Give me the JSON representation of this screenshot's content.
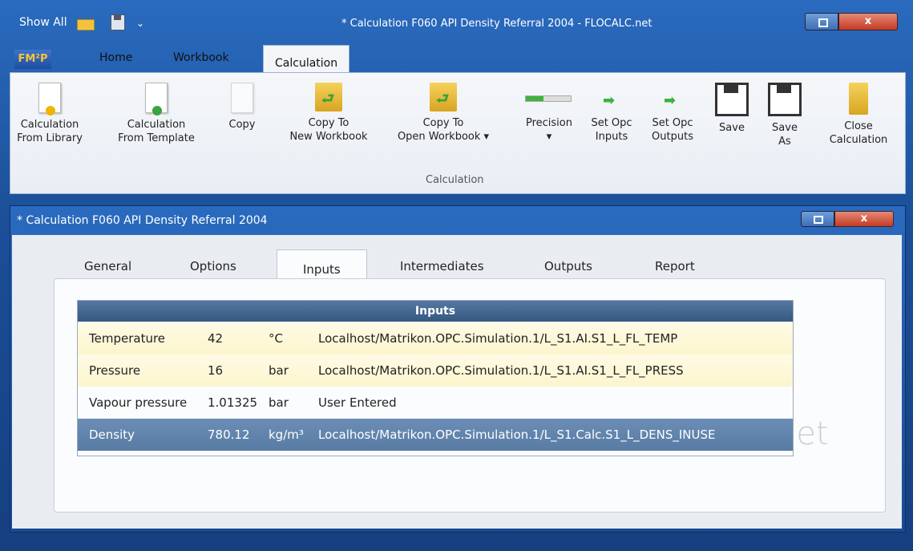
{
  "titlebar": {
    "show_all": "Show All",
    "chevron": "⌄",
    "title": "* Calculation F060 API Density Referral 2004  - FLOCALC.net",
    "close": "x"
  },
  "ribbon": {
    "fmp": "FM²P",
    "tabs": [
      "Home",
      "Workbook",
      "Calculation"
    ],
    "buttons": [
      {
        "l1": "Calculation",
        "l2": "From Library"
      },
      {
        "l1": "Calculation",
        "l2": "From Template"
      },
      {
        "l1": "Copy",
        "l2": ""
      },
      {
        "l1": "Copy To",
        "l2": "New Workbook"
      },
      {
        "l1": "Copy To",
        "l2": "Open Workbook ▾"
      },
      {
        "l1": "Precision",
        "l2": "▾"
      },
      {
        "l1": "Set Opc",
        "l2": "Inputs"
      },
      {
        "l1": "Set Opc",
        "l2": "Outputs"
      },
      {
        "l1": "Save",
        "l2": ""
      },
      {
        "l1": "Save",
        "l2": "As"
      },
      {
        "l1": "Close",
        "l2": "Calculation"
      }
    ],
    "group_label": "Calculation"
  },
  "child": {
    "title": "* Calculation F060 API Density Referral 2004",
    "close": "x",
    "tabs": [
      "General",
      "Options",
      "Inputs",
      "Intermediates",
      "Outputs",
      "Report"
    ],
    "watermark": "net",
    "grid_header": "Inputs",
    "rows": [
      {
        "name": "Temperature",
        "value": "42",
        "unit": "°C",
        "source": "Localhost/Matrikon.OPC.Simulation.1/L_S1.AI.S1_L_FL_TEMP"
      },
      {
        "name": "Pressure",
        "value": "16",
        "unit": "bar",
        "source": "Localhost/Matrikon.OPC.Simulation.1/L_S1.AI.S1_L_FL_PRESS"
      },
      {
        "name": "Vapour pressure",
        "value": "1.01325",
        "unit": "bar",
        "source": "User Entered"
      },
      {
        "name": "Density",
        "value": "780.12",
        "unit": "kg/m³",
        "source": "Localhost/Matrikon.OPC.Simulation.1/L_S1.Calc.S1_L_DENS_INUSE"
      }
    ]
  }
}
